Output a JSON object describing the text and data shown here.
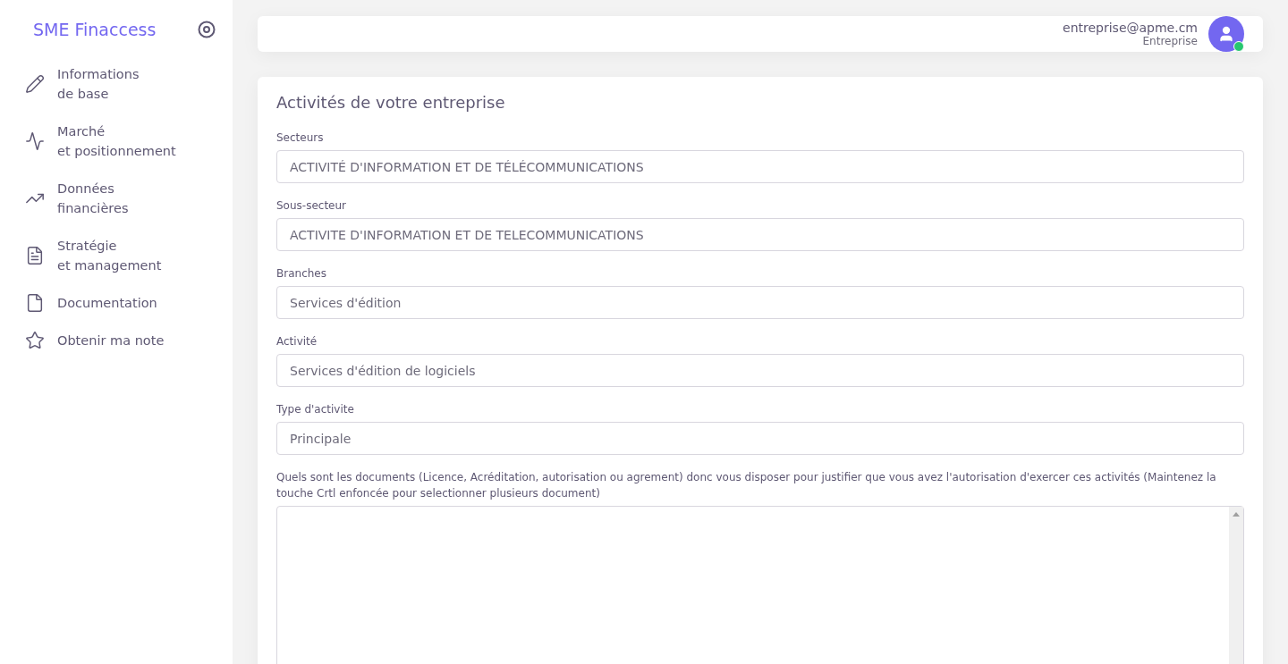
{
  "brand": {
    "title": "SME Finaccess"
  },
  "sidebar": {
    "items": [
      {
        "kind": "pencil",
        "label": "Informations\nde base"
      },
      {
        "kind": "activity",
        "label": "Marché\net positionnement"
      },
      {
        "kind": "trend",
        "label": "Données\nfinancières"
      },
      {
        "kind": "doc-text",
        "label": "Stratégie\net management"
      },
      {
        "kind": "doc",
        "label": "Documentation"
      },
      {
        "kind": "star",
        "label": "Obtenir ma note"
      }
    ]
  },
  "user": {
    "email": "entreprise@apme.cm",
    "role": "Entreprise",
    "online": true
  },
  "form": {
    "title": "Activités de votre entreprise",
    "fields": [
      {
        "label": "Secteurs",
        "value": "ACTIVITÉ D'INFORMATION ET DE TÉLÉCOMMUNICATIONS"
      },
      {
        "label": "Sous-secteur",
        "value": "ACTIVITE D'INFORMATION ET DE TELECOMMUNICATIONS"
      },
      {
        "label": "Branches",
        "value": "Services d'édition"
      },
      {
        "label": "Activité",
        "value": "Services d'édition de logiciels"
      },
      {
        "label": "Type d'activite",
        "value": "Principale"
      }
    ],
    "documents": {
      "label": "Quels sont les documents (Licence, Acréditation, autorisation ou agrement) donc vous disposer pour justifier que vous avez l'autorisation d'exercer ces activités (Maintenez la touche Crtl enfoncée pour selectionner plusieurs document)"
    }
  }
}
